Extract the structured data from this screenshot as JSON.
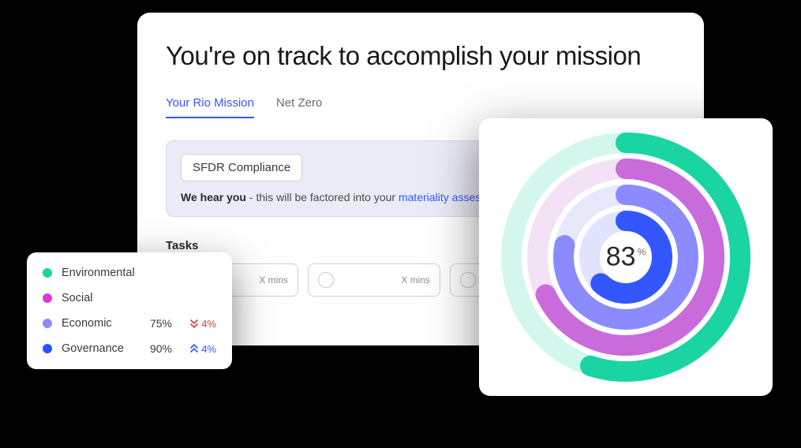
{
  "main": {
    "title": "You're on track to accomplish your mission",
    "tabs": [
      {
        "label": "Your Rio Mission",
        "active": true
      },
      {
        "label": "Net Zero",
        "active": false
      }
    ],
    "info": {
      "chip": "SFDR Compliance",
      "lead": "We hear you",
      "text": " - this will be factored into your ",
      "link": "materiality assessment"
    },
    "tasks_header": "Tasks",
    "tasks": [
      {
        "done": true,
        "duration": "X mins"
      },
      {
        "done": false,
        "duration": "X mins"
      },
      {
        "done": false,
        "duration": ""
      }
    ]
  },
  "legend": {
    "items": [
      {
        "label": "Environmental",
        "color": "#1bd4a3",
        "value": "",
        "delta": "",
        "dir": ""
      },
      {
        "label": "Social",
        "color": "#d63bd6",
        "value": "",
        "delta": "",
        "dir": ""
      },
      {
        "label": "Economic",
        "color": "#8b8bff",
        "value": "75%",
        "delta": "4%",
        "dir": "down"
      },
      {
        "label": "Governance",
        "color": "#2456ff",
        "value": "90%",
        "delta": "4%",
        "dir": "up"
      }
    ]
  },
  "donut": {
    "value": "83",
    "unit": "%",
    "rings": [
      {
        "color": "#1bd4a3",
        "track": "#d4f7ed",
        "radius": 145,
        "stroke": 26,
        "fraction": 0.55
      },
      {
        "color": "#c96bda",
        "track": "#f3e2f6",
        "radius": 112,
        "stroke": 26,
        "fraction": 0.68
      },
      {
        "color": "#8b8bff",
        "track": "#e8e8fb",
        "radius": 79,
        "stroke": 26,
        "fraction": 0.78
      },
      {
        "color": "#3456ff",
        "track": "#e0e4ff",
        "radius": 46,
        "stroke": 26,
        "fraction": 0.62
      }
    ]
  },
  "chart_data": {
    "type": "pie",
    "title": "",
    "center_value": 83,
    "center_unit": "%",
    "series": [
      {
        "name": "Environmental",
        "values": [
          55
        ],
        "color": "#1bd4a3"
      },
      {
        "name": "Social",
        "values": [
          68
        ],
        "color": "#c96bda"
      },
      {
        "name": "Economic",
        "values": [
          78
        ],
        "color": "#8b8bff"
      },
      {
        "name": "Governance",
        "values": [
          62
        ],
        "color": "#3456ff"
      }
    ],
    "legend": [
      {
        "name": "Environmental",
        "color": "#1bd4a3"
      },
      {
        "name": "Social",
        "color": "#d63bd6"
      },
      {
        "name": "Economic",
        "color": "#8b8bff",
        "value": 75,
        "delta": -4
      },
      {
        "name": "Governance",
        "color": "#2456ff",
        "value": 90,
        "delta": 4
      }
    ]
  }
}
